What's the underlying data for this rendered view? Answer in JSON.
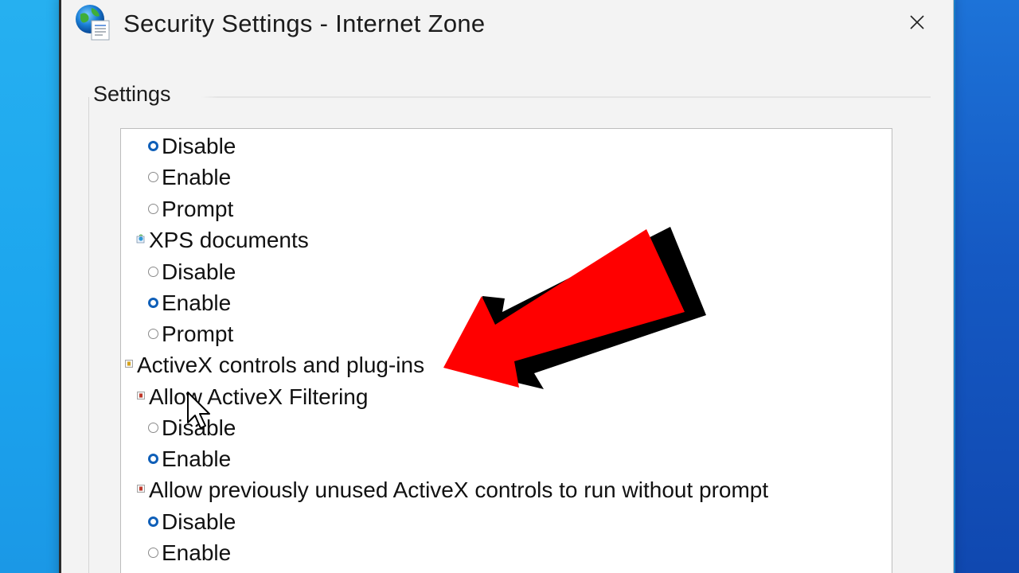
{
  "window": {
    "title": "Security Settings - Internet Zone",
    "icon": "internet-options-globe-icon",
    "close_icon": "close-icon"
  },
  "settings_group": {
    "label": "Settings"
  },
  "list": {
    "items": [
      {
        "type": "radio",
        "label": "Disable",
        "checked": true
      },
      {
        "type": "radio",
        "label": "Enable",
        "checked": false
      },
      {
        "type": "radio",
        "label": "Prompt",
        "checked": false
      },
      {
        "type": "setting",
        "label": "XPS documents",
        "icon": "xps-setting-icon"
      },
      {
        "type": "radio",
        "label": "Disable",
        "checked": false
      },
      {
        "type": "radio",
        "label": "Enable",
        "checked": true
      },
      {
        "type": "radio",
        "label": "Prompt",
        "checked": false
      },
      {
        "type": "category",
        "label": "ActiveX controls and plug-ins",
        "icon": "activex-category-icon"
      },
      {
        "type": "setting",
        "label": "Allow ActiveX Filtering",
        "icon": "activex-setting-icon"
      },
      {
        "type": "radio",
        "label": "Disable",
        "checked": false
      },
      {
        "type": "radio",
        "label": "Enable",
        "checked": true
      },
      {
        "type": "setting",
        "label": "Allow previously unused ActiveX controls to run without prompt",
        "icon": "activex-setting-icon"
      },
      {
        "type": "radio",
        "label": "Disable",
        "checked": true
      },
      {
        "type": "radio",
        "label": "Enable",
        "checked": false
      }
    ]
  },
  "colors": {
    "radio_selected": "#0f5fb8",
    "arrow_fill": "#ff0000",
    "arrow_shadow": "#000000"
  }
}
